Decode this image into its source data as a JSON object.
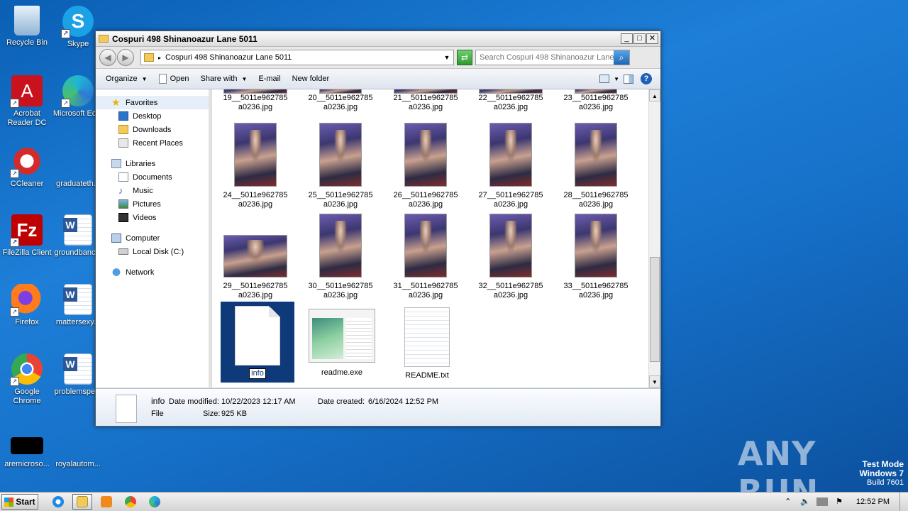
{
  "desktop": {
    "icons": [
      {
        "label": "Recycle Bin"
      },
      {
        "label": "Skype"
      },
      {
        "label": "Acrobat Reader DC"
      },
      {
        "label": "Microsoft Ed..."
      },
      {
        "label": "CCleaner"
      },
      {
        "label": "graduateth..."
      },
      {
        "label": "FileZilla Client"
      },
      {
        "label": "groundbanc..."
      },
      {
        "label": "Firefox"
      },
      {
        "label": "mattersexy..."
      },
      {
        "label": "Google Chrome"
      },
      {
        "label": "problemspe..."
      },
      {
        "label": "aremicroso..."
      },
      {
        "label": "royalautom..."
      }
    ]
  },
  "window": {
    "title": "Cospuri 498 Shinanoazur Lane 5011",
    "controls": {
      "min": "_",
      "max": "□",
      "close": "✕"
    },
    "address": "Cospuri 498 Shinanoazur Lane 5011",
    "search_placeholder": "Search Cospuri 498 Shinanoazur Lane ...",
    "toolbar": {
      "organize": "Organize",
      "open": "Open",
      "share": "Share with",
      "email": "E-mail",
      "new_folder": "New folder"
    },
    "nav": {
      "favorites": "Favorites",
      "desktop": "Desktop",
      "downloads": "Downloads",
      "recent": "Recent Places",
      "libraries": "Libraries",
      "documents": "Documents",
      "music": "Music",
      "pictures": "Pictures",
      "videos": "Videos",
      "computer": "Computer",
      "local_disk": "Local Disk (C:)",
      "network": "Network"
    },
    "files": {
      "row0": [
        {
          "l1": "19__5011e962785",
          "l2": "a0236.jpg"
        },
        {
          "l1": "20__5011e962785",
          "l2": "a0236.jpg"
        },
        {
          "l1": "21__5011e962785",
          "l2": "a0236.jpg"
        },
        {
          "l1": "22__5011e962785",
          "l2": "a0236.jpg"
        },
        {
          "l1": "23__5011e962785",
          "l2": "a0236.jpg"
        }
      ],
      "row1": [
        {
          "l1": "24__5011e962785",
          "l2": "a0236.jpg"
        },
        {
          "l1": "25__5011e962785",
          "l2": "a0236.jpg"
        },
        {
          "l1": "26__5011e962785",
          "l2": "a0236.jpg"
        },
        {
          "l1": "27__5011e962785",
          "l2": "a0236.jpg"
        },
        {
          "l1": "28__5011e962785",
          "l2": "a0236.jpg"
        }
      ],
      "row2": [
        {
          "l1": "29__5011e962785",
          "l2": "a0236.jpg"
        },
        {
          "l1": "30__5011e962785",
          "l2": "a0236.jpg"
        },
        {
          "l1": "31__5011e962785",
          "l2": "a0236.jpg"
        },
        {
          "l1": "32__5011e962785",
          "l2": "a0236.jpg"
        },
        {
          "l1": "33__5011e962785",
          "l2": "a0236.jpg"
        }
      ],
      "info": "info",
      "readme_exe": "readme.exe",
      "readme_txt": "README.txt"
    },
    "details": {
      "name": "info",
      "type": "File",
      "modified_label": "Date modified:",
      "modified": "10/22/2023 12:17 AM",
      "created_label": "Date created:",
      "created": "6/16/2024 12:52 PM",
      "size_label": "Size:",
      "size": "925 KB"
    }
  },
  "taskbar": {
    "start": "Start",
    "clock": "12:52 PM"
  },
  "watermark": "ANY RUN",
  "testmode": {
    "line1": "Test Mode",
    "line2": "Windows 7",
    "line3": "Build 7601"
  },
  "colors": {
    "desktop": "#1670c8",
    "selection": "#0f3a7a"
  }
}
